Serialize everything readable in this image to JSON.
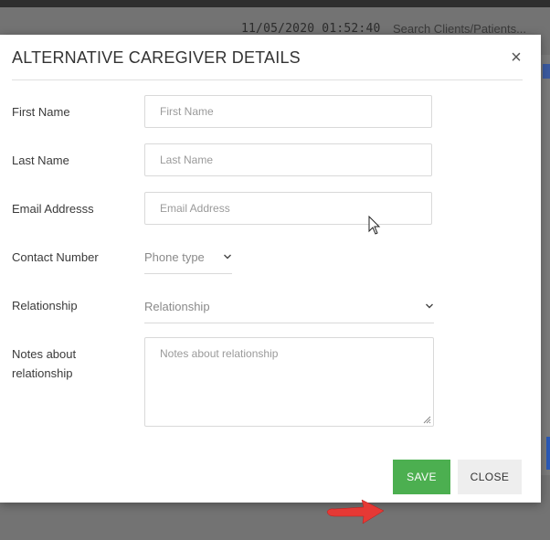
{
  "background": {
    "datetime": "11/05/2020 01:52:40",
    "search_placeholder": "Search Clients/Patients..."
  },
  "modal": {
    "title": "ALTERNATIVE CAREGIVER DETAILS",
    "close_glyph": "×",
    "fields": {
      "first_name": {
        "label": "First Name",
        "placeholder": "First Name",
        "value": ""
      },
      "last_name": {
        "label": "Last Name",
        "placeholder": "Last Name",
        "value": ""
      },
      "email": {
        "label": "Email Addresss",
        "placeholder": "Email Address",
        "value": ""
      },
      "contact": {
        "label": "Contact Number",
        "phone_type": "Phone type"
      },
      "relationship": {
        "label": "Relationship",
        "selected": "Relationship"
      },
      "notes": {
        "label_line1": "Notes about",
        "label_line2": "relationship",
        "placeholder": "Notes about relationship",
        "value": ""
      }
    },
    "buttons": {
      "save": "SAVE",
      "close": "CLOSE"
    }
  },
  "colors": {
    "save_button": "#4caf50",
    "close_button": "#eeeeee",
    "annotation_arrow": "#e53935",
    "overlay": "#737373"
  },
  "icons": {
    "close": "close-icon",
    "dropdown": "chevron-down-icon",
    "annotation": "arrow-right-icon",
    "cursor": "mouse-pointer-icon"
  }
}
